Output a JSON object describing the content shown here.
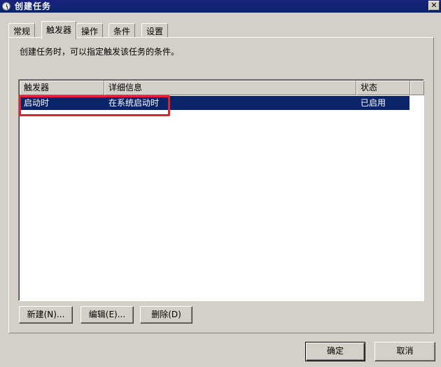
{
  "window": {
    "title": "创建任务",
    "close_glyph": "✕"
  },
  "tabs": [
    {
      "label": "常规"
    },
    {
      "label": "触发器",
      "active": true
    },
    {
      "label": "操作"
    },
    {
      "label": "条件"
    },
    {
      "label": "设置"
    }
  ],
  "description": "创建任务时，可以指定触发该任务的条件。",
  "table": {
    "columns": [
      "触发器",
      "详细信息",
      "状态"
    ],
    "rows": [
      {
        "trigger": "启动时",
        "details": "在系统启动时",
        "status": "已启用"
      }
    ]
  },
  "actions": {
    "new_label": "新建(N)...",
    "edit_label": "编辑(E)...",
    "delete_label": "删除(D)"
  },
  "footer": {
    "ok_label": "确定",
    "cancel_label": "取消"
  },
  "colors": {
    "selection": "#0a246a",
    "highlight_box": "#d9262e",
    "dialog_bg": "#d4d0c8"
  }
}
